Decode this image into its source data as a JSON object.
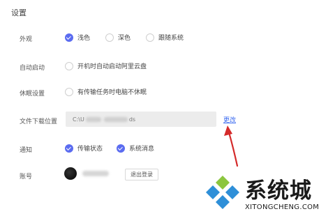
{
  "page": {
    "title": "设置"
  },
  "appearance": {
    "label": "外观",
    "options": [
      {
        "label": "浅色",
        "checked": true
      },
      {
        "label": "深色",
        "checked": false
      },
      {
        "label": "跟随系统",
        "checked": false
      }
    ]
  },
  "autostart": {
    "label": "自动启动",
    "option_label": "开机时自动启动阿里云盘",
    "checked": false
  },
  "sleep": {
    "label": "休眠设置",
    "option_label": "有传输任务时电脑不休眠",
    "checked": false
  },
  "download": {
    "label": "文件下载位置",
    "path_prefix": "C:\\U",
    "path_suffix": "ds",
    "change_label": "更改"
  },
  "notify": {
    "label": "通知",
    "options": [
      {
        "label": "传输状态",
        "checked": true
      },
      {
        "label": "系统消息",
        "checked": true
      }
    ]
  },
  "account": {
    "label": "账号",
    "logout_label": "退出登录"
  },
  "watermark": {
    "brand": "系统城",
    "url": "XITONGCHENG.COM"
  },
  "colors": {
    "accent": "#5b6cf0",
    "link": "#3d6cf0",
    "annotation_arrow": "#d42a2a",
    "logo_blue": "#2e8fd8"
  }
}
